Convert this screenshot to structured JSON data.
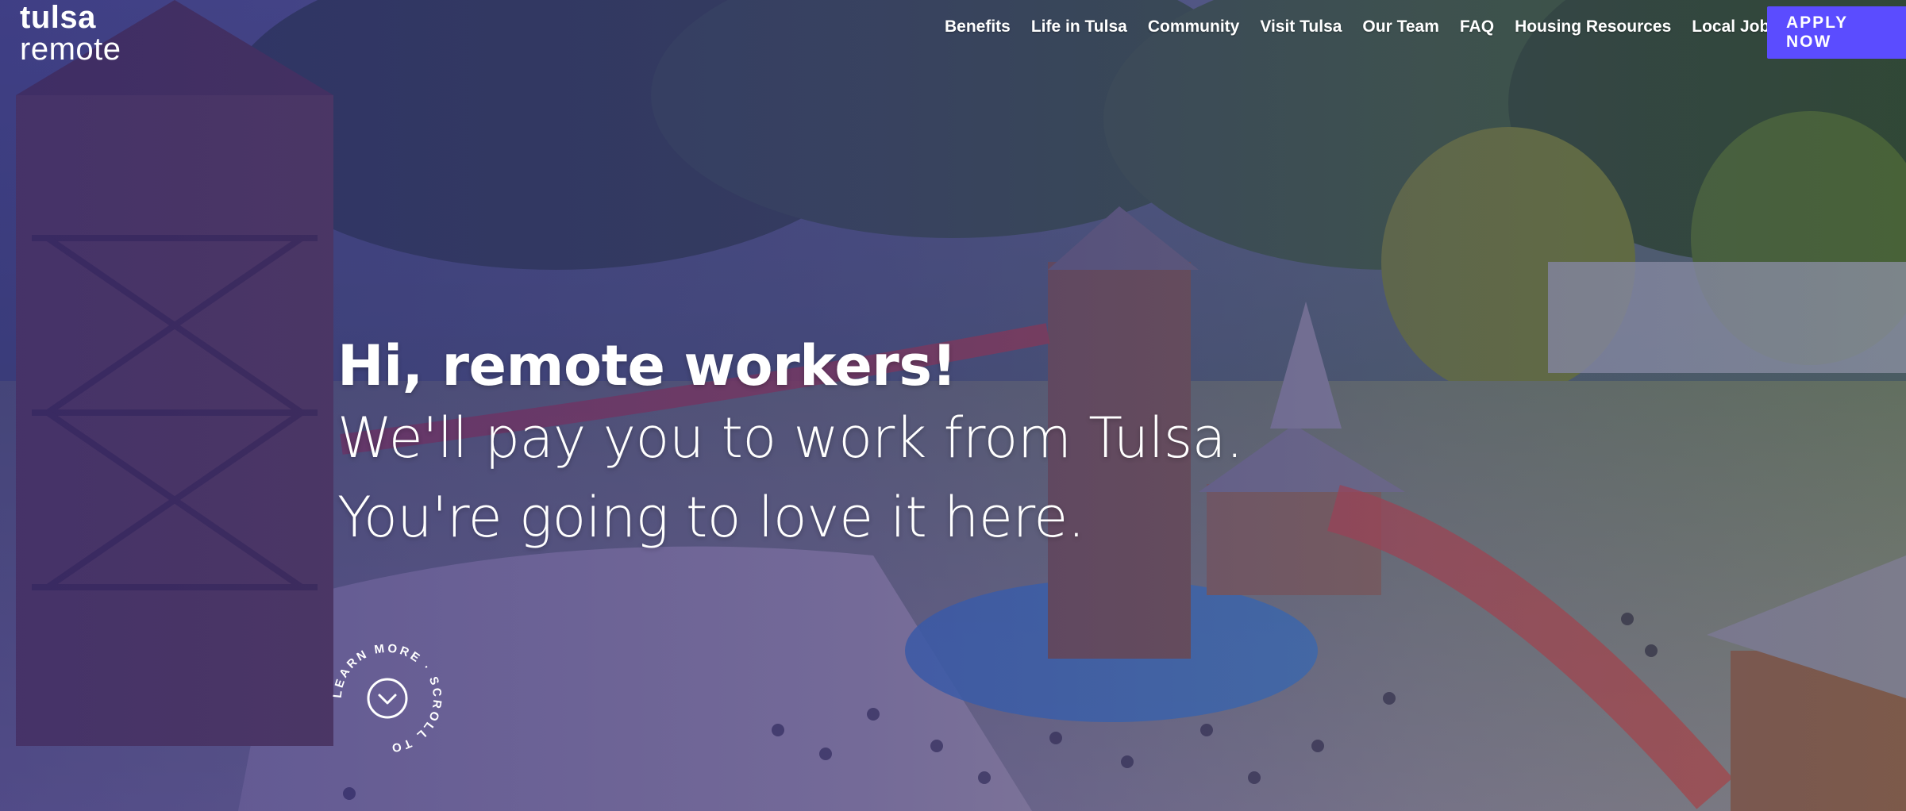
{
  "logo": {
    "line1": "tulsa",
    "line2": "remote"
  },
  "nav": {
    "items": [
      {
        "label": "Benefits"
      },
      {
        "label": "Life in Tulsa"
      },
      {
        "label": "Community"
      },
      {
        "label": "Visit Tulsa"
      },
      {
        "label": "Our Team"
      },
      {
        "label": "FAQ"
      },
      {
        "label": "Housing Resources"
      },
      {
        "label": "Local Jobs"
      }
    ],
    "apply_label": "APPLY NOW",
    "apply_arrow": "›"
  },
  "hero": {
    "heading": "Hi, remote workers!",
    "line2": "We'll pay you to work from Tulsa.",
    "line3": "You're going to love it here."
  },
  "scroll": {
    "text": "LEARN MORE · SCROLL TO",
    "icon": "chevron-down-icon"
  },
  "colors": {
    "accent": "#5b4cff",
    "overlay": "#3a2c96"
  }
}
